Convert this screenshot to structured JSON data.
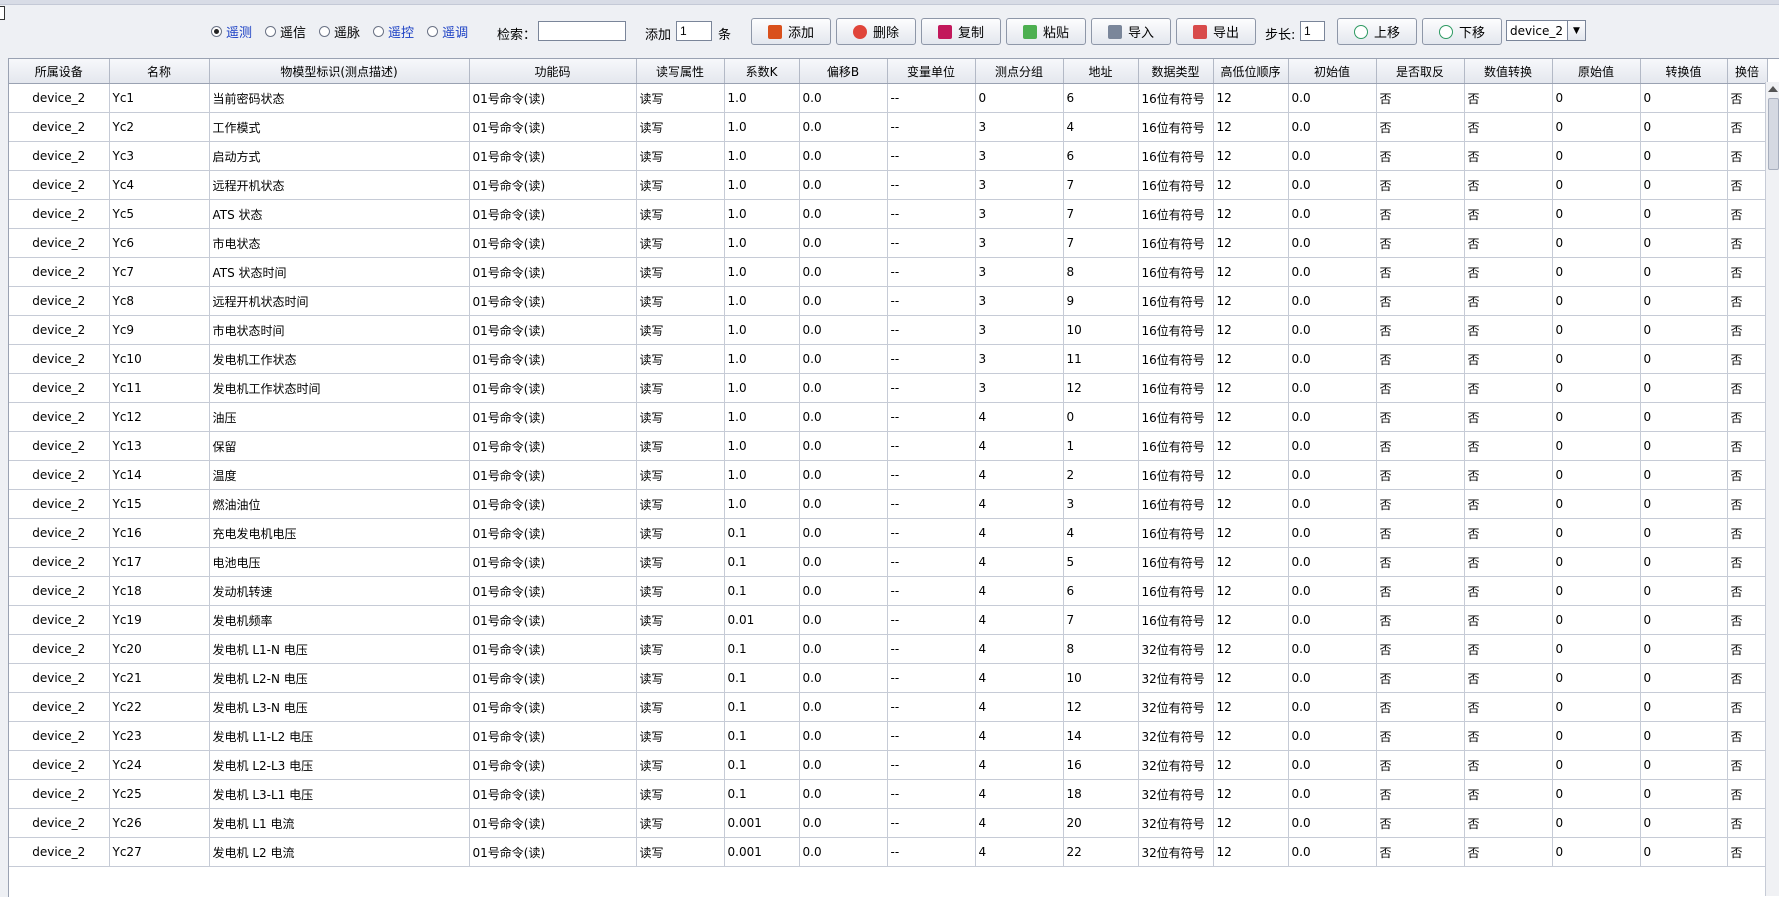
{
  "toolbar": {
    "radios": [
      {
        "label": "遥测",
        "checked": true,
        "blue": true
      },
      {
        "label": "遥信",
        "checked": false,
        "blue": false
      },
      {
        "label": "遥脉",
        "checked": false,
        "blue": false
      },
      {
        "label": "遥控",
        "checked": false,
        "blue": true
      },
      {
        "label": "遥调",
        "checked": false,
        "blue": true
      }
    ],
    "search_label": "检索：",
    "search_value": "",
    "add_label": "添加",
    "add_count": "1",
    "add_unit": "条",
    "buttons": {
      "add": "添加",
      "delete": "删除",
      "copy": "复制",
      "paste": "粘贴",
      "import": "导入",
      "export": "导出",
      "up": "上移",
      "down": "下移"
    },
    "step_label": "步长:",
    "step_value": "1",
    "device_select": "device_2"
  },
  "table": {
    "headers": [
      "所属设备",
      "名称",
      "物模型标识(测点描述)",
      "功能码",
      "读写属性",
      "系数K",
      "偏移B",
      "变量单位",
      "测点分组",
      "地址",
      "数据类型",
      "高低位顺序",
      "初始值",
      "是否取反",
      "数值转换",
      "原始值",
      "转换值",
      "换倍"
    ],
    "rows": [
      [
        "device_2",
        "Yc1",
        "当前密码状态",
        "01号命令(读)",
        "读写",
        "1.0",
        "0.0",
        "--",
        "0",
        "6",
        "16位有符号",
        "12",
        "0.0",
        "否",
        "否",
        "0",
        "0",
        "否"
      ],
      [
        "device_2",
        "Yc2",
        "工作模式",
        "01号命令(读)",
        "读写",
        "1.0",
        "0.0",
        "--",
        "3",
        "4",
        "16位有符号",
        "12",
        "0.0",
        "否",
        "否",
        "0",
        "0",
        "否"
      ],
      [
        "device_2",
        "Yc3",
        "启动方式",
        "01号命令(读)",
        "读写",
        "1.0",
        "0.0",
        "--",
        "3",
        "6",
        "16位有符号",
        "12",
        "0.0",
        "否",
        "否",
        "0",
        "0",
        "否"
      ],
      [
        "device_2",
        "Yc4",
        "远程开机状态",
        "01号命令(读)",
        "读写",
        "1.0",
        "0.0",
        "--",
        "3",
        "7",
        "16位有符号",
        "12",
        "0.0",
        "否",
        "否",
        "0",
        "0",
        "否"
      ],
      [
        "device_2",
        "Yc5",
        "ATS 状态",
        "01号命令(读)",
        "读写",
        "1.0",
        "0.0",
        "--",
        "3",
        "7",
        "16位有符号",
        "12",
        "0.0",
        "否",
        "否",
        "0",
        "0",
        "否"
      ],
      [
        "device_2",
        "Yc6",
        "市电状态",
        "01号命令(读)",
        "读写",
        "1.0",
        "0.0",
        "--",
        "3",
        "7",
        "16位有符号",
        "12",
        "0.0",
        "否",
        "否",
        "0",
        "0",
        "否"
      ],
      [
        "device_2",
        "Yc7",
        "ATS 状态时间",
        "01号命令(读)",
        "读写",
        "1.0",
        "0.0",
        "--",
        "3",
        "8",
        "16位有符号",
        "12",
        "0.0",
        "否",
        "否",
        "0",
        "0",
        "否"
      ],
      [
        "device_2",
        "Yc8",
        "远程开机状态时间",
        "01号命令(读)",
        "读写",
        "1.0",
        "0.0",
        "--",
        "3",
        "9",
        "16位有符号",
        "12",
        "0.0",
        "否",
        "否",
        "0",
        "0",
        "否"
      ],
      [
        "device_2",
        "Yc9",
        "市电状态时间",
        "01号命令(读)",
        "读写",
        "1.0",
        "0.0",
        "--",
        "3",
        "10",
        "16位有符号",
        "12",
        "0.0",
        "否",
        "否",
        "0",
        "0",
        "否"
      ],
      [
        "device_2",
        "Yc10",
        "发电机工作状态",
        "01号命令(读)",
        "读写",
        "1.0",
        "0.0",
        "--",
        "3",
        "11",
        "16位有符号",
        "12",
        "0.0",
        "否",
        "否",
        "0",
        "0",
        "否"
      ],
      [
        "device_2",
        "Yc11",
        "发电机工作状态时间",
        "01号命令(读)",
        "读写",
        "1.0",
        "0.0",
        "--",
        "3",
        "12",
        "16位有符号",
        "12",
        "0.0",
        "否",
        "否",
        "0",
        "0",
        "否"
      ],
      [
        "device_2",
        "Yc12",
        "油压",
        "01号命令(读)",
        "读写",
        "1.0",
        "0.0",
        "--",
        "4",
        "0",
        "16位有符号",
        "12",
        "0.0",
        "否",
        "否",
        "0",
        "0",
        "否"
      ],
      [
        "device_2",
        "Yc13",
        "保留",
        "01号命令(读)",
        "读写",
        "1.0",
        "0.0",
        "--",
        "4",
        "1",
        "16位有符号",
        "12",
        "0.0",
        "否",
        "否",
        "0",
        "0",
        "否"
      ],
      [
        "device_2",
        "Yc14",
        "温度",
        "01号命令(读)",
        "读写",
        "1.0",
        "0.0",
        "--",
        "4",
        "2",
        "16位有符号",
        "12",
        "0.0",
        "否",
        "否",
        "0",
        "0",
        "否"
      ],
      [
        "device_2",
        "Yc15",
        "燃油油位",
        "01号命令(读)",
        "读写",
        "1.0",
        "0.0",
        "--",
        "4",
        "3",
        "16位有符号",
        "12",
        "0.0",
        "否",
        "否",
        "0",
        "0",
        "否"
      ],
      [
        "device_2",
        "Yc16",
        "充电发电机电压",
        "01号命令(读)",
        "读写",
        "0.1",
        "0.0",
        "--",
        "4",
        "4",
        "16位有符号",
        "12",
        "0.0",
        "否",
        "否",
        "0",
        "0",
        "否"
      ],
      [
        "device_2",
        "Yc17",
        "电池电压",
        "01号命令(读)",
        "读写",
        "0.1",
        "0.0",
        "--",
        "4",
        "5",
        "16位有符号",
        "12",
        "0.0",
        "否",
        "否",
        "0",
        "0",
        "否"
      ],
      [
        "device_2",
        "Yc18",
        "发动机转速",
        "01号命令(读)",
        "读写",
        "0.1",
        "0.0",
        "--",
        "4",
        "6",
        "16位有符号",
        "12",
        "0.0",
        "否",
        "否",
        "0",
        "0",
        "否"
      ],
      [
        "device_2",
        "Yc19",
        "发电机频率",
        "01号命令(读)",
        "读写",
        "0.01",
        "0.0",
        "--",
        "4",
        "7",
        "16位有符号",
        "12",
        "0.0",
        "否",
        "否",
        "0",
        "0",
        "否"
      ],
      [
        "device_2",
        "Yc20",
        "发电机 L1-N 电压",
        "01号命令(读)",
        "读写",
        "0.1",
        "0.0",
        "--",
        "4",
        "8",
        "32位有符号",
        "12",
        "0.0",
        "否",
        "否",
        "0",
        "0",
        "否"
      ],
      [
        "device_2",
        "Yc21",
        "发电机 L2-N 电压",
        "01号命令(读)",
        "读写",
        "0.1",
        "0.0",
        "--",
        "4",
        "10",
        "32位有符号",
        "12",
        "0.0",
        "否",
        "否",
        "0",
        "0",
        "否"
      ],
      [
        "device_2",
        "Yc22",
        "发电机 L3-N 电压",
        "01号命令(读)",
        "读写",
        "0.1",
        "0.0",
        "--",
        "4",
        "12",
        "32位有符号",
        "12",
        "0.0",
        "否",
        "否",
        "0",
        "0",
        "否"
      ],
      [
        "device_2",
        "Yc23",
        "发电机 L1-L2 电压",
        "01号命令(读)",
        "读写",
        "0.1",
        "0.0",
        "--",
        "4",
        "14",
        "32位有符号",
        "12",
        "0.0",
        "否",
        "否",
        "0",
        "0",
        "否"
      ],
      [
        "device_2",
        "Yc24",
        "发电机 L2-L3 电压",
        "01号命令(读)",
        "读写",
        "0.1",
        "0.0",
        "--",
        "4",
        "16",
        "32位有符号",
        "12",
        "0.0",
        "否",
        "否",
        "0",
        "0",
        "否"
      ],
      [
        "device_2",
        "Yc25",
        "发电机 L3-L1 电压",
        "01号命令(读)",
        "读写",
        "0.1",
        "0.0",
        "--",
        "4",
        "18",
        "32位有符号",
        "12",
        "0.0",
        "否",
        "否",
        "0",
        "0",
        "否"
      ],
      [
        "device_2",
        "Yc26",
        "发电机 L1 电流",
        "01号命令(读)",
        "读写",
        "0.001",
        "0.0",
        "--",
        "4",
        "20",
        "32位有符号",
        "12",
        "0.0",
        "否",
        "否",
        "0",
        "0",
        "否"
      ],
      [
        "device_2",
        "Yc27",
        "发电机 L2 电流",
        "01号命令(读)",
        "读写",
        "0.001",
        "0.0",
        "--",
        "4",
        "22",
        "32位有符号",
        "12",
        "0.0",
        "否",
        "否",
        "0",
        "0",
        "否"
      ]
    ]
  }
}
